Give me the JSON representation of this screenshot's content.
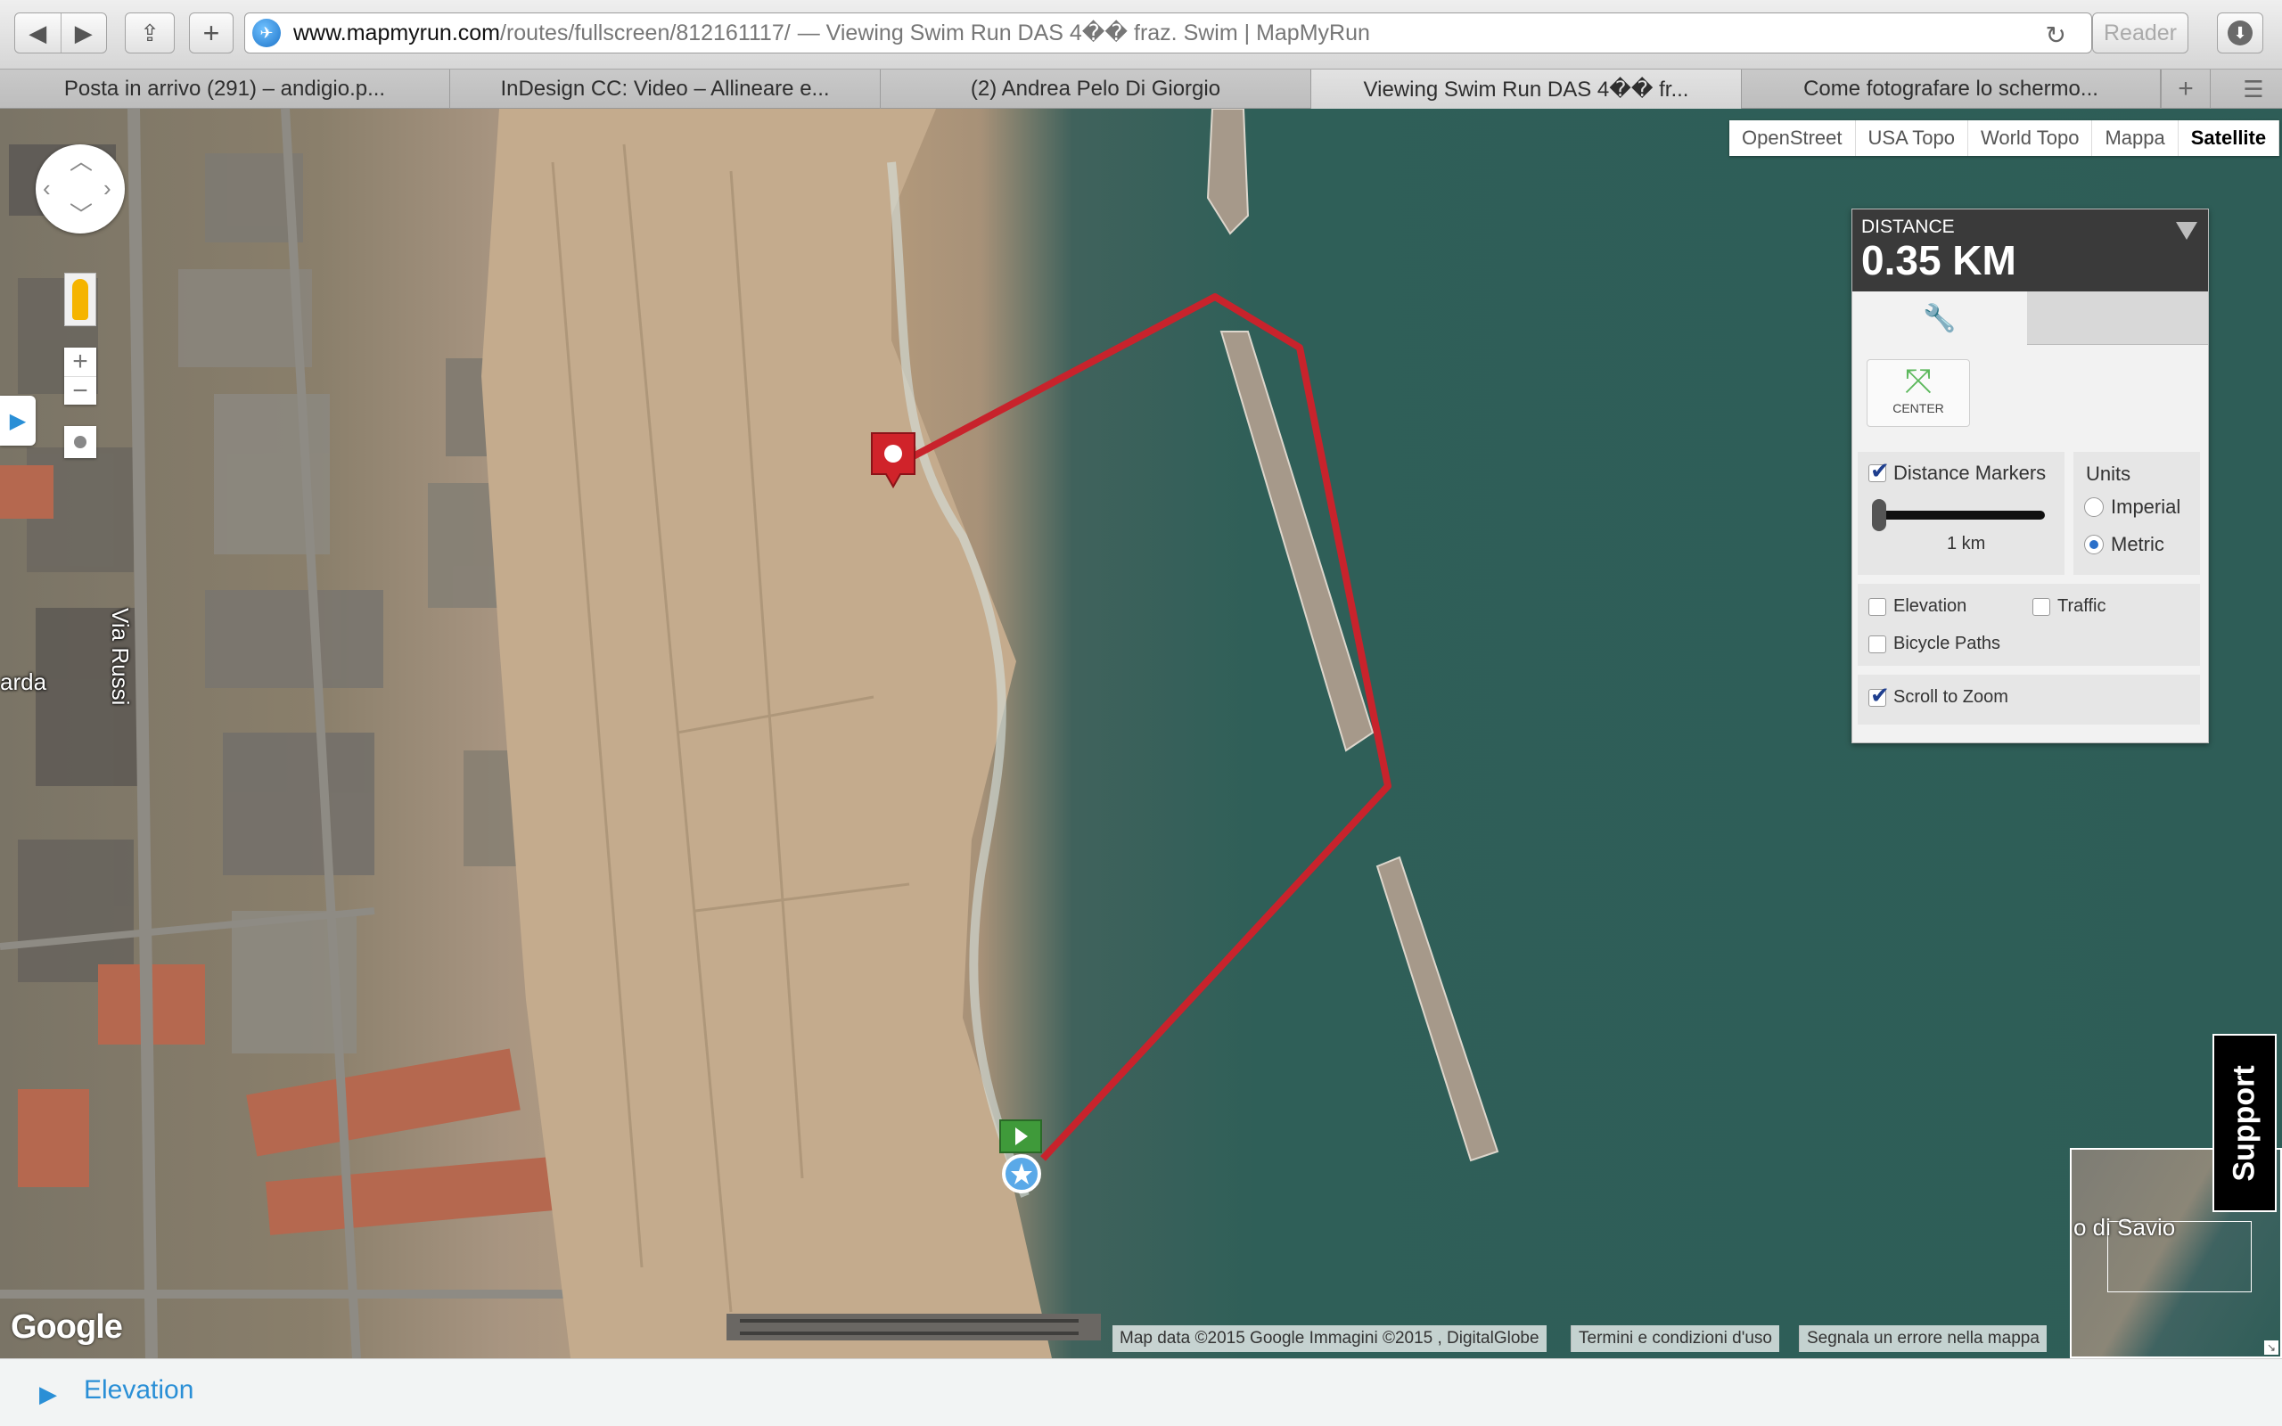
{
  "browser": {
    "url_host": "www.mapmyrun.com",
    "url_path": "/routes/fullscreen/812161117/",
    "page_title": "— Viewing Swim Run DAS 4�� fraz. Swim | MapMyRun",
    "reader_label": "Reader",
    "tabs": [
      {
        "label": "Posta in arrivo (291) – andigio.p...",
        "active": false
      },
      {
        "label": "InDesign CC: Video – Allineare e...",
        "active": false
      },
      {
        "label": "(2) Andrea Pelo Di Giorgio",
        "active": false
      },
      {
        "label": "Viewing Swim Run DAS 4�� fr...",
        "active": true
      },
      {
        "label": "Come fotografare lo schermo...",
        "active": false
      }
    ]
  },
  "map": {
    "types": [
      "OpenStreet",
      "USA Topo",
      "World Topo",
      "Mappa",
      "Satellite"
    ],
    "active_type": "Satellite",
    "street_labels": {
      "via_russi": "Via Russi",
      "arda": "arda"
    },
    "google_logo": "Google",
    "attribution": {
      "data": "Map data ©2015 Google Immagini ©2015 , DigitalGlobe",
      "terms": "Termini e condizioni d'uso",
      "report": "Segnala un errore nella mappa"
    },
    "overview_label": "o di Savio",
    "route_color": "#c8232c",
    "support_label": "Support"
  },
  "distance_panel": {
    "label": "DISTANCE",
    "value": "0.35 KM",
    "center_label": "CENTER",
    "distance_markers": {
      "label": "Distance Markers",
      "checked": true,
      "slider_value": "1 km"
    },
    "units": {
      "title": "Units",
      "imperial": "Imperial",
      "metric": "Metric",
      "selected": "Metric"
    },
    "layers": {
      "elevation": "Elevation",
      "traffic": "Traffic",
      "bicycle_paths": "Bicycle Paths"
    },
    "scroll_to_zoom": {
      "label": "Scroll to Zoom",
      "checked": true
    }
  },
  "footer": {
    "elevation_label": "Elevation"
  }
}
